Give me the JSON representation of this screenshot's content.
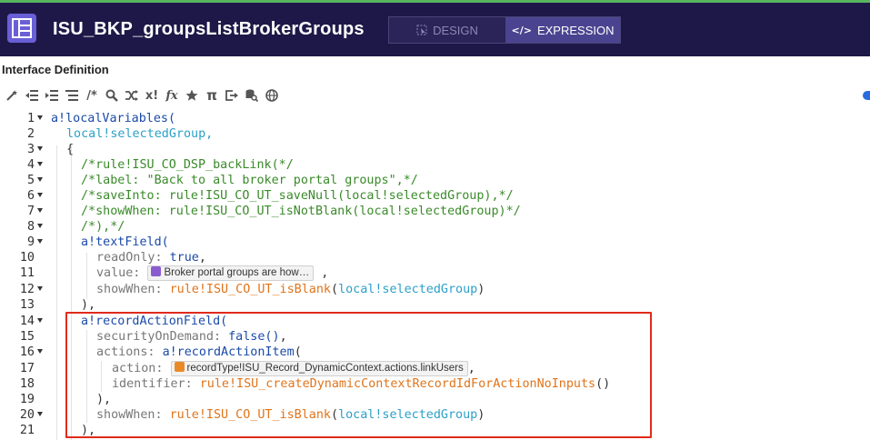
{
  "header": {
    "title": "ISU_BKP_groupsListBrokerGroups",
    "modes": {
      "design": "DESIGN",
      "expression": "EXPRESSION"
    },
    "active_mode": "EXPRESSION"
  },
  "section_label": "Interface Definition",
  "toolbar": {
    "buttons": [
      "magic-wand-icon",
      "outdent-icon",
      "indent-icon",
      "list-icon",
      "comment-toggle",
      "search-icon",
      "shuffle-icon",
      "x-function-icon",
      "fx-icon",
      "star-icon",
      "pi-icon",
      "export-icon",
      "database-search-icon",
      "globe-icon"
    ],
    "comment_label": "/*",
    "x_label": "x!",
    "fx_label": "fx",
    "pi_label": "π"
  },
  "editor": {
    "line_numbers": [
      "1",
      "2",
      "3",
      "4",
      "5",
      "6",
      "7",
      "8",
      "9",
      "10",
      "11",
      "12",
      "13",
      "14",
      "15",
      "16",
      "17",
      "18",
      "19",
      "20",
      "21"
    ],
    "lines": {
      "l1": "a!localVariables(",
      "l2": "local!selectedGroup,",
      "l3": "{",
      "l4": "/*rule!ISU_CO_DSP_backLink(*/",
      "l5": "/*label: \"Back to all broker portal groups\",*/",
      "l6": "/*saveInto: rule!ISU_CO_UT_saveNull(local!selectedGroup),*/",
      "l7": "/*showWhen: rule!ISU_CO_UT_isNotBlank(local!selectedGroup)*/",
      "l8": "/*),*/",
      "l9": "a!textField(",
      "l10_prop": "readOnly:",
      "l10_val": "true",
      "l11_prop": "value:",
      "l11_token": "Broker portal groups are how…",
      "l12_prop": "showWhen:",
      "l12_rule": "rule!ISU_CO_UT_isBlank",
      "l12_arg": "local!selectedGroup",
      "l13": "),",
      "l14": "a!recordActionField(",
      "l15_prop": "securityOnDemand:",
      "l15_val": "false()",
      "l16_prop": "actions:",
      "l16_fn": "a!recordActionItem",
      "l17_prop": "action:",
      "l17_token": "recordType!ISU_Record_DynamicContext.actions.linkUsers",
      "l18_prop": "identifier:",
      "l18_rule": "rule!ISU_createDynamicContextRecordIdForActionNoInputs",
      "l19": "),",
      "l20_prop": "showWhen:",
      "l20_rule": "rule!ISU_CO_UT_isBlank",
      "l20_arg": "local!selectedGroup",
      "l21": "),"
    }
  },
  "colors": {
    "header_bg": "#1e1848",
    "accent_border": "#58b55f",
    "app_icon": "#6a5fd6",
    "keyword": "#1a4aa8",
    "local_var": "#2ca0c8",
    "comment": "#3a8a2a",
    "rule": "#e0741b",
    "highlight_box": "#e02a1a"
  }
}
